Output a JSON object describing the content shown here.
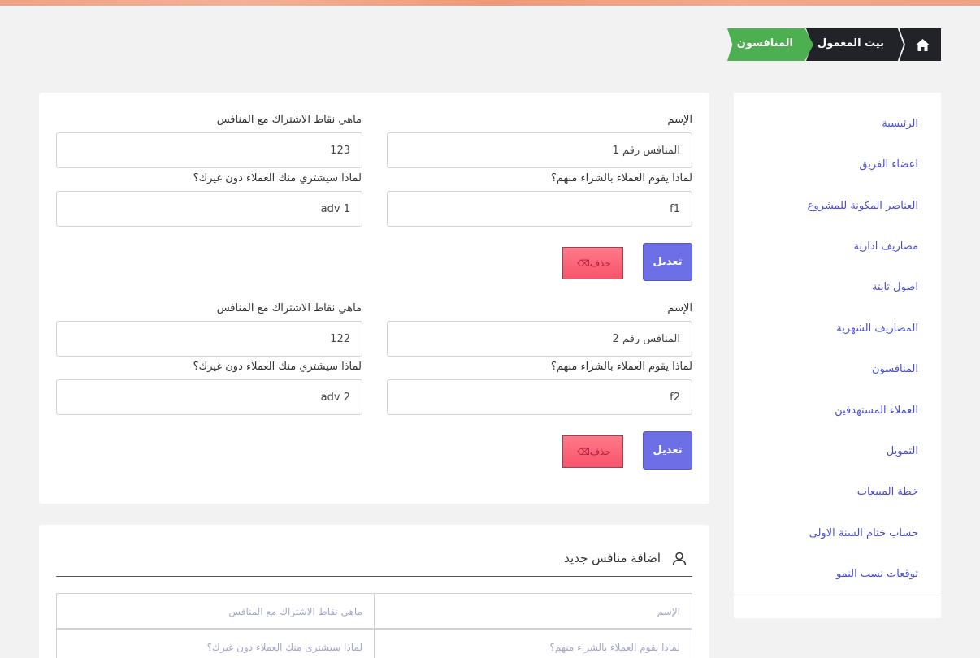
{
  "breadcrumb": {
    "home_icon": "home-icon",
    "items": [
      "بيت المعمول",
      "المنافسون"
    ]
  },
  "sidebar": {
    "items": [
      {
        "label": "الرئيسية"
      },
      {
        "label": "اعضاء الفريق"
      },
      {
        "label": "العناصر المكونة للمشروع"
      },
      {
        "label": "مصاريف ادارية"
      },
      {
        "label": "اصول ثابتة"
      },
      {
        "label": "المصاريف الشهرية"
      },
      {
        "label": "المنافسون"
      },
      {
        "label": "العملاء المستهدفين"
      },
      {
        "label": "التمويل"
      },
      {
        "label": "خطة المبيعات"
      },
      {
        "label": "حساب ختام السنة الاولى"
      },
      {
        "label": "توقعات نسب النمو"
      }
    ]
  },
  "competitors": [
    {
      "name_label": "الإسم",
      "name_value": "المنافس رقم 1",
      "common_label": "ماهي نقاط الاشتراك مع المنافس",
      "common_value": "123",
      "why_buy_label": "لماذا يقوم العملاء بالشراء منهم؟",
      "why_buy_value": "f1",
      "advantage_label": "لماذا سيشتري منك العملاء دون غيرك؟",
      "advantage_value": "adv 1",
      "edit_label": "تعديل",
      "delete_label": "حذف"
    },
    {
      "name_label": "الإسم",
      "name_value": "المنافس رقم 2",
      "common_label": "ماهي نقاط الاشتراك مع المنافس",
      "common_value": "122",
      "why_buy_label": "لماذا يقوم العملاء بالشراء منهم؟",
      "why_buy_value": "f2",
      "advantage_label": "لماذا سيشتري منك العملاء دون غيرك؟",
      "advantage_value": "adv 2",
      "edit_label": "تعديل",
      "delete_label": "حذف"
    }
  ],
  "new_competitor": {
    "title": "اضافة منافس جديد",
    "name_placeholder": "الإسم",
    "common_placeholder": "ماهى نقاط الاشتراك مع المنافس",
    "why_buy_placeholder": "لماذا يقوم العملاء بالشراء منهم؟",
    "advantage_placeholder": "لماذا سيشترى منك العملاء دون غيرك؟"
  },
  "colors": {
    "accent": "#6c6fe6",
    "danger": "#f8546a",
    "active_crumb": "#4caf50",
    "dark": "#222329",
    "link": "#4a4fcf"
  }
}
